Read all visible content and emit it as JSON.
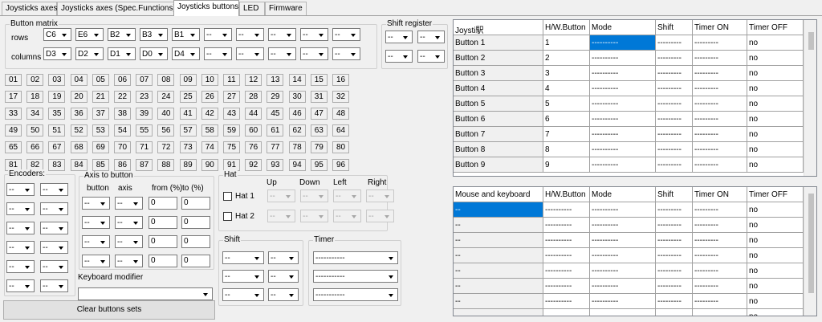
{
  "tabs": [
    {
      "label": "Joysticks axes"
    },
    {
      "label": "Joysticks axes (Spec.Functions)"
    },
    {
      "label": "Joysticks buttons"
    },
    {
      "label": "LED"
    },
    {
      "label": "Firmware"
    }
  ],
  "button_matrix": {
    "title": "Button matrix",
    "rows_label": "rows",
    "columns_label": "columns",
    "rows": [
      "C6",
      "E6",
      "B2",
      "B3",
      "B1",
      "--",
      "--",
      "--",
      "--",
      "--"
    ],
    "columns": [
      "D3",
      "D2",
      "D1",
      "D0",
      "D4",
      "--",
      "--",
      "--",
      "--",
      "--"
    ]
  },
  "shift_register": {
    "title": "Shift register",
    "values": [
      "--",
      "--",
      "--",
      "--"
    ]
  },
  "buttons": [
    "01",
    "02",
    "03",
    "04",
    "05",
    "06",
    "07",
    "08",
    "09",
    "10",
    "11",
    "12",
    "13",
    "14",
    "15",
    "16",
    "17",
    "18",
    "19",
    "20",
    "21",
    "22",
    "23",
    "24",
    "25",
    "26",
    "27",
    "28",
    "29",
    "30",
    "31",
    "32",
    "33",
    "34",
    "35",
    "36",
    "37",
    "38",
    "39",
    "40",
    "41",
    "42",
    "43",
    "44",
    "45",
    "46",
    "47",
    "48",
    "49",
    "50",
    "51",
    "52",
    "53",
    "54",
    "55",
    "56",
    "57",
    "58",
    "59",
    "60",
    "61",
    "62",
    "63",
    "64",
    "65",
    "66",
    "67",
    "68",
    "69",
    "70",
    "71",
    "72",
    "73",
    "74",
    "75",
    "76",
    "77",
    "78",
    "79",
    "80",
    "81",
    "82",
    "83",
    "84",
    "85",
    "86",
    "87",
    "88",
    "89",
    "90",
    "91",
    "92",
    "93",
    "94",
    "95",
    "96"
  ],
  "encoders": {
    "title": "Encoders:",
    "values": [
      "--",
      "--",
      "--",
      "--",
      "--",
      "--",
      "--",
      "--",
      "--",
      "--",
      "--",
      "--"
    ]
  },
  "axis_to_button": {
    "title": "Axis to button",
    "col_button": "button",
    "col_axis": "axis",
    "col_from": "from (%)",
    "col_to": "to (%)",
    "rows": [
      {
        "button": "--",
        "axis": "--",
        "from": "0",
        "to": "0"
      },
      {
        "button": "--",
        "axis": "--",
        "from": "0",
        "to": "0"
      },
      {
        "button": "--",
        "axis": "--",
        "from": "0",
        "to": "0"
      },
      {
        "button": "--",
        "axis": "--",
        "from": "0",
        "to": "0"
      }
    ]
  },
  "keyboard_modifier": {
    "label": "Keyboard modifier",
    "value": ""
  },
  "clear_button": "Clear buttons sets",
  "hat": {
    "title": "Hat",
    "up": "Up",
    "down": "Down",
    "left": "Left",
    "right": "Right",
    "rows": [
      {
        "label": "Hat 1",
        "values": [
          "--",
          "--",
          "--",
          "--"
        ]
      },
      {
        "label": "Hat 2",
        "values": [
          "--",
          "--",
          "--",
          "--"
        ]
      }
    ]
  },
  "shift": {
    "title": "Shift",
    "values": [
      "--",
      "--",
      "--",
      "--",
      "--",
      "--"
    ]
  },
  "timer": {
    "title": "Timer",
    "values": [
      "-----------",
      "-----------",
      "-----------"
    ]
  },
  "joystick_table": {
    "headers": [
      "Joysti駅",
      "H/W.Button",
      "Mode",
      "Shift",
      "Timer ON",
      "Timer OFF"
    ],
    "rows": [
      {
        "name": "Button 1",
        "hw": "1",
        "mode": "----------",
        "shift": "---------",
        "ton": "---------",
        "toff": "no"
      },
      {
        "name": "Button 2",
        "hw": "2",
        "mode": "----------",
        "shift": "---------",
        "ton": "---------",
        "toff": "no"
      },
      {
        "name": "Button 3",
        "hw": "3",
        "mode": "----------",
        "shift": "---------",
        "ton": "---------",
        "toff": "no"
      },
      {
        "name": "Button 4",
        "hw": "4",
        "mode": "----------",
        "shift": "---------",
        "ton": "---------",
        "toff": "no"
      },
      {
        "name": "Button 5",
        "hw": "5",
        "mode": "----------",
        "shift": "---------",
        "ton": "---------",
        "toff": "no"
      },
      {
        "name": "Button 6",
        "hw": "6",
        "mode": "----------",
        "shift": "---------",
        "ton": "---------",
        "toff": "no"
      },
      {
        "name": "Button 7",
        "hw": "7",
        "mode": "----------",
        "shift": "---------",
        "ton": "---------",
        "toff": "no"
      },
      {
        "name": "Button 8",
        "hw": "8",
        "mode": "----------",
        "shift": "---------",
        "ton": "---------",
        "toff": "no"
      },
      {
        "name": "Button 9",
        "hw": "9",
        "mode": "----------",
        "shift": "---------",
        "ton": "---------",
        "toff": "no"
      }
    ]
  },
  "mouse_table": {
    "headers": [
      "Mouse and keyboard",
      "H/W.Button",
      "Mode",
      "Shift",
      "Timer ON",
      "Timer OFF"
    ],
    "rows": [
      {
        "name": "--",
        "hw": "----------",
        "mode": "----------",
        "shift": "---------",
        "ton": "---------",
        "toff": "no"
      },
      {
        "name": "--",
        "hw": "----------",
        "mode": "----------",
        "shift": "---------",
        "ton": "---------",
        "toff": "no"
      },
      {
        "name": "--",
        "hw": "----------",
        "mode": "----------",
        "shift": "---------",
        "ton": "---------",
        "toff": "no"
      },
      {
        "name": "--",
        "hw": "----------",
        "mode": "----------",
        "shift": "---------",
        "ton": "---------",
        "toff": "no"
      },
      {
        "name": "--",
        "hw": "----------",
        "mode": "----------",
        "shift": "---------",
        "ton": "---------",
        "toff": "no"
      },
      {
        "name": "--",
        "hw": "----------",
        "mode": "----------",
        "shift": "---------",
        "ton": "---------",
        "toff": "no"
      },
      {
        "name": "--",
        "hw": "----------",
        "mode": "----------",
        "shift": "---------",
        "ton": "---------",
        "toff": "no"
      },
      {
        "name": "--",
        "hw": "----------",
        "mode": "----------",
        "shift": "---------",
        "ton": "---------",
        "toff": "no"
      }
    ]
  },
  "colors": {
    "selection": "#0078d7",
    "window_bg": "#f0f0f0"
  }
}
